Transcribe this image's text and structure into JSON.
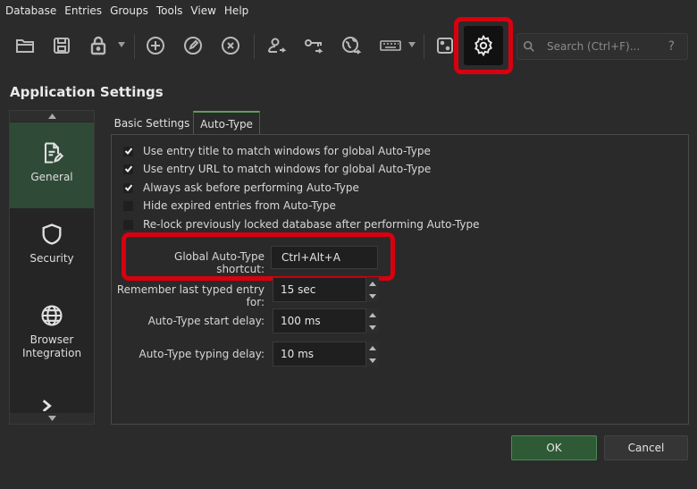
{
  "menu": [
    "Database",
    "Entries",
    "Groups",
    "Tools",
    "View",
    "Help"
  ],
  "toolbar": {
    "icons": [
      "open-database-icon",
      "save-database-icon",
      "lock-database-icon",
      "add-entry-icon",
      "edit-entry-icon",
      "delete-entry-icon",
      "copy-username-icon",
      "copy-password-icon",
      "open-url-icon",
      "auto-type-icon",
      "password-generator-icon",
      "settings-icon"
    ],
    "search_placeholder": "Search (Ctrl+F)...",
    "help": "?"
  },
  "title": "Application Settings",
  "categories": [
    {
      "label": "General",
      "icon": "document-edit-icon",
      "active": true
    },
    {
      "label": "Security",
      "icon": "shield-icon",
      "active": false
    },
    {
      "label": "Browser Integration",
      "icon": "globe-icon",
      "active": false
    },
    {
      "label": "",
      "icon": "terminal-icon",
      "active": false
    }
  ],
  "tabs": [
    {
      "label": "Basic Settings",
      "active": false
    },
    {
      "label": "Auto-Type",
      "active": true
    }
  ],
  "options": [
    {
      "label": "Use entry title to match windows for global Auto-Type",
      "checked": true
    },
    {
      "label": "Use entry URL to match windows for global Auto-Type",
      "checked": true
    },
    {
      "label": "Always ask before performing Auto-Type",
      "checked": true
    },
    {
      "label": "Hide expired entries from Auto-Type",
      "checked": false
    },
    {
      "label": "Re-lock previously locked database after performing Auto-Type",
      "checked": false
    }
  ],
  "fields": {
    "shortcut_label": "Global Auto-Type shortcut:",
    "shortcut_value": "Ctrl+Alt+A",
    "remember_label": "Remember last typed entry for:",
    "remember_value": "15 sec",
    "start_delay_label": "Auto-Type start delay:",
    "start_delay_value": "100 ms",
    "typing_delay_label": "Auto-Type typing delay:",
    "typing_delay_value": "10 ms"
  },
  "buttons": {
    "ok": "OK",
    "cancel": "Cancel"
  },
  "colors": {
    "accent_green": "#5aa05a",
    "highlight_red": "#d8000f"
  }
}
